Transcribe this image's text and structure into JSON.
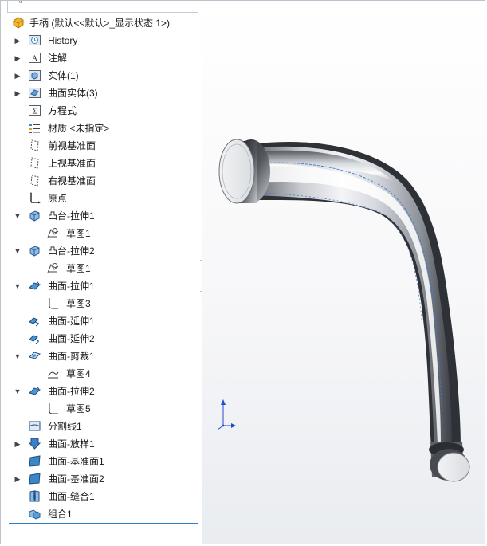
{
  "tree": {
    "root_label": "手柄  (默认<<默认>_显示状态 1>)",
    "items": [
      {
        "label": "History",
        "icon": "history-folder-icon",
        "expander": "collapsed"
      },
      {
        "label": "注解",
        "icon": "annotations-icon",
        "expander": "collapsed"
      },
      {
        "label": "实体(1)",
        "icon": "solid-bodies-folder-icon",
        "expander": "collapsed"
      },
      {
        "label": "曲面实体(3)",
        "icon": "surface-bodies-folder-icon",
        "expander": "collapsed"
      },
      {
        "label": "方程式",
        "icon": "equations-icon",
        "expander": "none"
      },
      {
        "label": "材质 <未指定>",
        "icon": "material-icon",
        "expander": "none"
      },
      {
        "label": "前视基准面",
        "icon": "plane-icon",
        "expander": "none"
      },
      {
        "label": "上视基准面",
        "icon": "plane-icon",
        "expander": "none"
      },
      {
        "label": "右视基准面",
        "icon": "plane-icon",
        "expander": "none"
      },
      {
        "label": "原点",
        "icon": "origin-icon",
        "expander": "none"
      },
      {
        "label": "凸台-拉伸1",
        "icon": "boss-extrude-icon",
        "expander": "expanded"
      },
      {
        "label": "草图1",
        "icon": "sketch-icon",
        "expander": "none"
      },
      {
        "label": "凸台-拉伸2",
        "icon": "boss-extrude-icon",
        "expander": "expanded"
      },
      {
        "label": "草图1",
        "icon": "sketch-icon",
        "expander": "none"
      },
      {
        "label": "曲面-拉伸1",
        "icon": "surface-extrude-icon",
        "expander": "expanded"
      },
      {
        "label": "草图3",
        "icon": "sketch-curve-icon",
        "expander": "none"
      },
      {
        "label": "曲面-延伸1",
        "icon": "surface-extend-icon",
        "expander": "none"
      },
      {
        "label": "曲面-延伸2",
        "icon": "surface-extend-icon",
        "expander": "none"
      },
      {
        "label": "曲面-剪裁1",
        "icon": "surface-trim-icon",
        "expander": "expanded"
      },
      {
        "label": "草图4",
        "icon": "sketch-trim-icon",
        "expander": "none"
      },
      {
        "label": "曲面-拉伸2",
        "icon": "surface-extrude-icon",
        "expander": "expanded"
      },
      {
        "label": "草图5",
        "icon": "sketch-curve-icon",
        "expander": "none"
      },
      {
        "label": "分割线1",
        "icon": "split-line-icon",
        "expander": "none"
      },
      {
        "label": "曲面-放样1",
        "icon": "surface-loft-icon",
        "expander": "collapsed"
      },
      {
        "label": "曲面-基准面1",
        "icon": "planar-surface-icon",
        "expander": "none"
      },
      {
        "label": "曲面-基准面2",
        "icon": "planar-surface-icon",
        "expander": "collapsed"
      },
      {
        "label": "曲面-缝合1",
        "icon": "surface-knit-icon",
        "expander": "none"
      },
      {
        "label": "组合1",
        "icon": "combine-icon",
        "expander": "none"
      }
    ]
  },
  "colors": {
    "accent": "#2f7dc4",
    "icon_blue": "#3d86c6",
    "triad_blue": "#1f4fd1"
  }
}
